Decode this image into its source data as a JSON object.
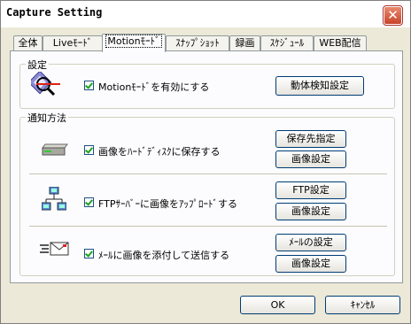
{
  "window": {
    "title": "Capture Setting",
    "close_glyph": "✕"
  },
  "tabs": [
    {
      "label": "全体"
    },
    {
      "label": "Liveﾓｰﾄﾞ"
    },
    {
      "label": "Motionﾓｰﾄﾞ"
    },
    {
      "label": "ｽﾅｯﾌﾟｼｮｯﾄ"
    },
    {
      "label": "録画"
    },
    {
      "label": "ｽｹｼﾞｭｰﾙ"
    },
    {
      "label": "WEB配信"
    }
  ],
  "active_tab": "Motionﾓｰﾄﾞ",
  "settings_group": {
    "label": "設定",
    "motion_checkbox": {
      "label": "Motionﾓｰﾄﾞを有効にする",
      "checked": true
    },
    "detect_button": "動体検知設定"
  },
  "notify_group": {
    "label": "通知方法",
    "hdd": {
      "label": "画像をﾊｰﾄﾞﾃﾞｨｽｸに保存する",
      "checked": true,
      "button1": "保存先指定",
      "button2": "画像設定",
      "icon": "hard-drive-icon"
    },
    "ftp": {
      "label": "FTPｻｰﾊﾞｰに画像をｱｯﾌﾟﾛｰﾄﾞする",
      "checked": true,
      "button1": "FTP設定",
      "button2": "画像設定",
      "icon": "network-icon"
    },
    "mail": {
      "label": "ﾒｰﾙに画像を添付して送信する",
      "checked": true,
      "button1": "ﾒｰﾙの設定",
      "button2": "画像設定",
      "icon": "mail-icon"
    }
  },
  "footer": {
    "ok": "OK",
    "cancel": "ｷｬﾝｾﾙ"
  }
}
